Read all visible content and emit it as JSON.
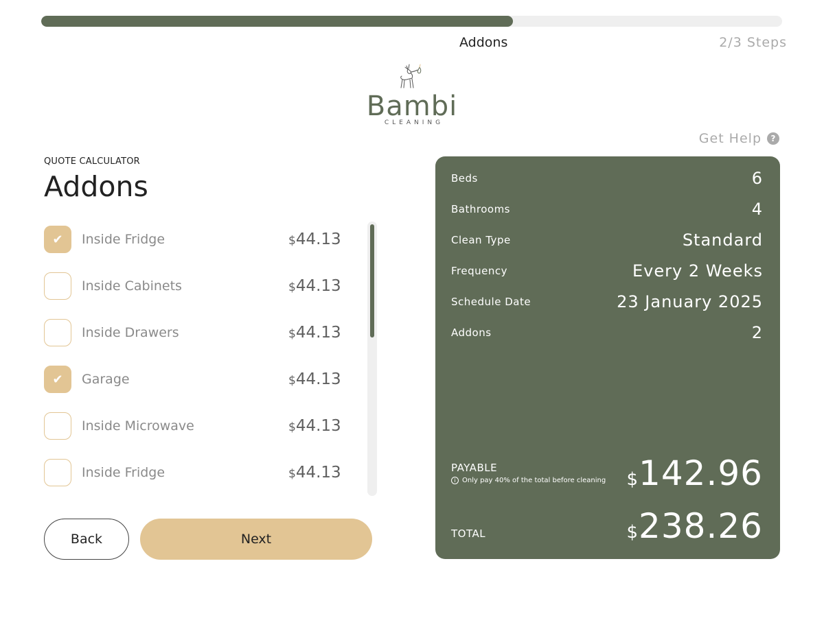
{
  "progress": {
    "percent": 63.7
  },
  "step": {
    "name": "Addons",
    "count": "2/3 Steps"
  },
  "brand": {
    "name": "Bambi",
    "tagline": "CLEANING"
  },
  "help": {
    "label": "Get Help",
    "icon": "help-icon",
    "icon_glyph": "?"
  },
  "section": {
    "eyebrow": "QUOTE CALCULATOR",
    "title": "Addons"
  },
  "currency_symbol": "$",
  "check_glyph": "✔",
  "addons": [
    {
      "label": "Inside Fridge",
      "price": "44.13",
      "checked": true
    },
    {
      "label": "Inside Cabinets",
      "price": "44.13",
      "checked": false
    },
    {
      "label": "Inside Drawers",
      "price": "44.13",
      "checked": false
    },
    {
      "label": "Garage",
      "price": "44.13",
      "checked": true
    },
    {
      "label": "Inside Microwave",
      "price": "44.13",
      "checked": false
    },
    {
      "label": "Inside Fridge",
      "price": "44.13",
      "checked": false
    }
  ],
  "buttons": {
    "back": "Back",
    "next": "Next"
  },
  "summary": {
    "rows": [
      {
        "label": "Beds",
        "value": "6"
      },
      {
        "label": "Bathrooms",
        "value": "4"
      },
      {
        "label": "Clean Type",
        "value": "Standard"
      },
      {
        "label": "Frequency",
        "value": "Every 2 Weeks"
      },
      {
        "label": "Schedule Date",
        "value": "23 January 2025"
      },
      {
        "label": "Addons",
        "value": "2"
      }
    ],
    "payable_label": "PAYABLE",
    "payable_note": "Only pay 40% of the total before cleaning",
    "info_glyph": "i",
    "payable_amount": "142.96",
    "total_label": "TOTAL",
    "total_amount": "238.26"
  },
  "colors": {
    "accent_green": "#606c57",
    "accent_tan": "#e2c594",
    "muted_text": "#aaaaaa"
  }
}
